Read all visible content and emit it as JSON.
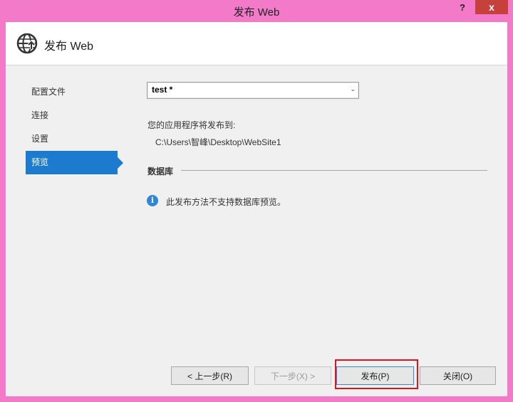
{
  "window": {
    "title": "发布 Web",
    "help": "?",
    "close": "x"
  },
  "header": {
    "title": "发布 Web",
    "icon": "globe-publish-icon"
  },
  "nav": {
    "items": [
      {
        "label": "配置文件"
      },
      {
        "label": "连接"
      },
      {
        "label": "设置"
      },
      {
        "label": "预览",
        "active": true
      }
    ]
  },
  "profile": {
    "value": "test *",
    "arrow": "⌄"
  },
  "preview": {
    "publish_label": "您的应用程序将发布到:",
    "publish_path": "C:\\Users\\智峰\\Desktop\\WebSite1",
    "database_title": "数据库",
    "info_icon": "i",
    "info_text": "此发布方法不支持数据库预览。"
  },
  "buttons": {
    "prev": "< 上一步(R)",
    "next": "下一步(X) >",
    "publish": "发布(P)",
    "close": "关闭(O)"
  },
  "colors": {
    "accent": "#1c7acf",
    "titlebar": "#f27ac9",
    "close": "#c7413c",
    "highlight": "#e0141e"
  }
}
